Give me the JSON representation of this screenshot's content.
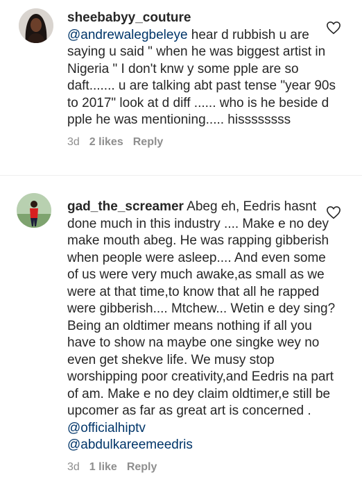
{
  "comments": [
    {
      "username": "sheebabyy_couture",
      "mention": "@andrewalegbeleye",
      "text": " hear d rubbish u are saying u said \" when he was biggest artist in Nigeria \" I don't knw y some pple are so daft....... u are talking abt past tense \"year 90s to 2017\" look at d diff ...... who is he beside d pple he was mentioning..... hissssssss",
      "time": "3d",
      "likes": "2 likes",
      "reply": "Reply"
    },
    {
      "username": "gad_the_screamer",
      "text": " Abeg eh, Eedris hasnt done much in this industry .... Make e no dey make mouth abeg. He was rapping gibberish when people were asleep.... And even some of us were very much awake,as small as we were at that time,to know that all he rapped were gibberish.... Mtchew... Wetin e dey sing? Being an oldtimer means nothing if all you have to show na maybe one singke wey no even get shekve life. We musy stop worshipping poor creativity,and Eedris na part of am. Make e no dey claim oldtimer,e still be upcomer as far as great art is concerned . ",
      "mention1": "@officialhiptv",
      "mention2": "@abdulkareemeedris",
      "time": "3d",
      "likes": "1 like",
      "reply": "Reply"
    }
  ]
}
